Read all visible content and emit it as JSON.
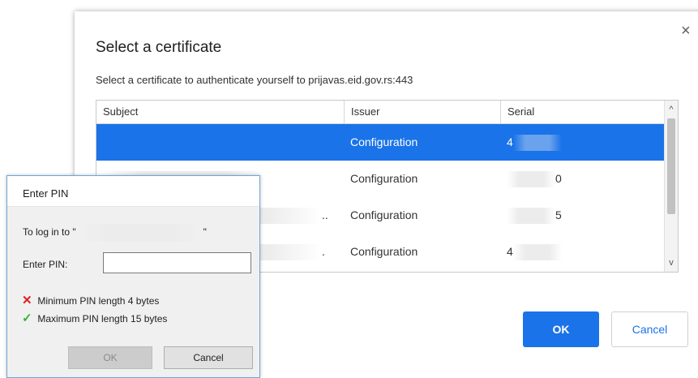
{
  "cert_dialog": {
    "title": "Select a certificate",
    "close_glyph": "×",
    "subtitle": "Select a certificate to authenticate yourself to prijavas.eid.gov.rs:443",
    "columns": {
      "subject": "Subject",
      "issuer": "Issuer",
      "serial": "Serial"
    },
    "rows": [
      {
        "subject": "",
        "issuer": "Configuration",
        "serial_visible": "4",
        "selected": true
      },
      {
        "subject": "",
        "issuer": "Configuration",
        "serial_visible": "0",
        "selected": false
      },
      {
        "subject": "..",
        "issuer": "Configuration",
        "serial_visible": "5",
        "selected": false
      },
      {
        "subject": ".",
        "issuer": "Configuration",
        "serial_visible": "4",
        "selected": false
      }
    ],
    "scroll_up_glyph": "^",
    "scroll_down_glyph": "v",
    "ok_label": "OK",
    "cancel_label": "Cancel",
    "accent_color": "#1a73e8"
  },
  "pin_dialog": {
    "title": "Enter PIN",
    "login_prefix": "To log in to \"",
    "login_suffix": "\"",
    "pin_label": "Enter PIN:",
    "pin_value": "",
    "rules": [
      {
        "icon": "x-icon",
        "glyph": "✕",
        "text": "Minimum PIN length 4 bytes",
        "status_color": "#e02020"
      },
      {
        "icon": "checkmark-icon",
        "glyph": "✓",
        "text": "Maximum PIN length 15 bytes",
        "status_color": "#35b335"
      }
    ],
    "ok_label": "OK",
    "cancel_label": "Cancel"
  }
}
